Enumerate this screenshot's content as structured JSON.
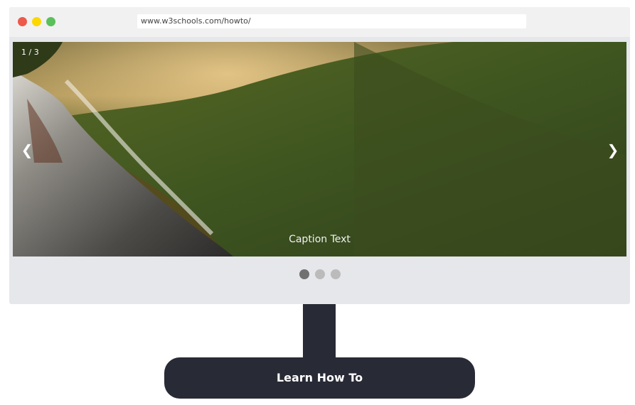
{
  "browser": {
    "url": "www.w3schools.com/howto/"
  },
  "slideshow": {
    "number_text": "1 / 3",
    "caption": "Caption Text",
    "prev_label": "❮",
    "next_label": "❯",
    "total_slides": 3,
    "active_index": 1
  },
  "stand": {
    "label": "Learn How To"
  },
  "colors": {
    "window_close": "#ed594a",
    "window_minimize": "#fdd800",
    "window_maximize": "#5ac05a",
    "stand": "#282a35",
    "dot_active": "#717171",
    "dot_inactive": "#bbbbbb"
  }
}
